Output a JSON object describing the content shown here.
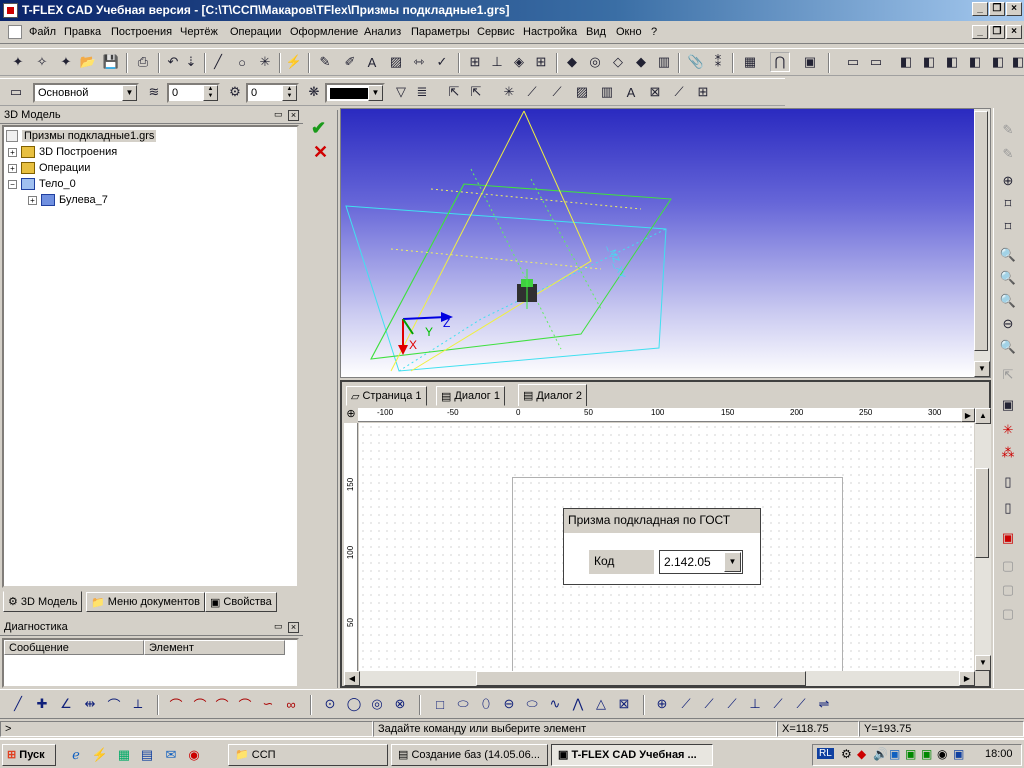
{
  "window": {
    "title": "T-FLEX CAD Учебная версия - [C:\\T\\ССП\\Макаров\\TFlex\\Призмы подкладные1.grs]"
  },
  "menu": [
    "Файл",
    "Правка",
    "Построения",
    "Чертёж",
    "Операции",
    "Оформление",
    "Анализ",
    "Параметры",
    "Сервис",
    "Настройка",
    "Вид",
    "Окно",
    "?"
  ],
  "props_bar": {
    "layer": "Основной",
    "level1": "0",
    "level2": "0"
  },
  "model_panel": {
    "title": "3D Модель",
    "tree": [
      {
        "label": "Призмы подкладные1.grs",
        "depth": 0
      },
      {
        "label": "3D Построения",
        "depth": 1
      },
      {
        "label": "Операции",
        "depth": 1
      },
      {
        "label": "Тело_0",
        "depth": 1
      },
      {
        "label": "Булева_7",
        "depth": 2
      }
    ],
    "tabs": [
      "3D Модель",
      "Меню документов",
      "Свойства"
    ]
  },
  "diagnostics": {
    "title": "Диагностика",
    "columns": [
      "Сообщение",
      "Элемент"
    ]
  },
  "viewport": {
    "axis_x": "X",
    "axis_y": "Y",
    "axis_z": "Z"
  },
  "doc_tabs": [
    "Страница 1",
    "Диалог 1",
    "Диалог 2"
  ],
  "ruler": {
    "h": [
      "-100",
      "-50",
      "0",
      "50",
      "100",
      "150",
      "200",
      "250",
      "300"
    ],
    "v": [
      "150",
      "100",
      "50"
    ]
  },
  "dialog": {
    "title": "Призма подкладная по ГОСТ",
    "field_label": "Код",
    "field_value": "2.142.05"
  },
  "status": {
    "prompt": ">",
    "hint": "Задайте команду или выберите элемент",
    "x": "X=118.75",
    "y": "Y=193.75"
  },
  "taskbar": {
    "start": "Пуск",
    "buttons": [
      "ССП",
      "Создание баз (14.05.06...",
      "T-FLEX CAD Учебная ..."
    ],
    "lang": "RL",
    "clock": "18:00"
  },
  "colors": {
    "title_start": "#0a246a",
    "viewport_top": "#2828c8",
    "viewport_bottom": "#ffffff"
  }
}
